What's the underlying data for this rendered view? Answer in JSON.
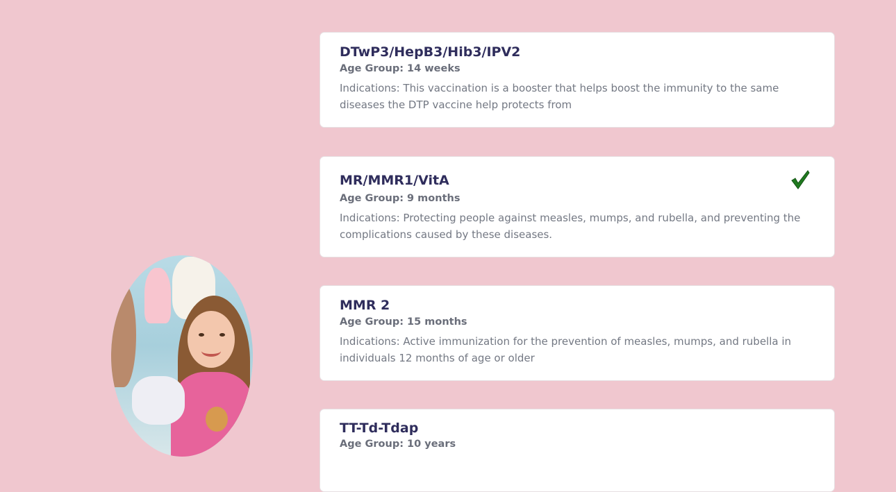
{
  "vaccines": [
    {
      "name": "DTwP3/HepB3/Hib3/IPV2",
      "age_group": "Age Group: 14 weeks",
      "indications": "Indications: This vaccination is a booster that helps boost the immunity to the same diseases the DTP vaccine help protects from",
      "completed": false
    },
    {
      "name": "MR/MMR1/VitA",
      "age_group": "Age Group: 9 months",
      "indications": "Indications: Protecting people against measles, mumps, and rubella, and preventing the complications caused by these diseases.",
      "completed": true,
      "check_color": "#1f7a1f"
    },
    {
      "name": "MMR 2",
      "age_group": "Age Group: 15 months",
      "indications": "Indications: Active immunization for the prevention of measles, mumps, and rubella in individuals 12 months of age or older",
      "completed": false
    },
    {
      "name": "TT-Td-Tdap",
      "age_group": "Age Group: 10 years",
      "indications": "",
      "completed": false
    }
  ],
  "colors": {
    "background": "#f0c7cf",
    "card": "#ffffff",
    "title": "#2f2d5c",
    "text": "#737883"
  }
}
